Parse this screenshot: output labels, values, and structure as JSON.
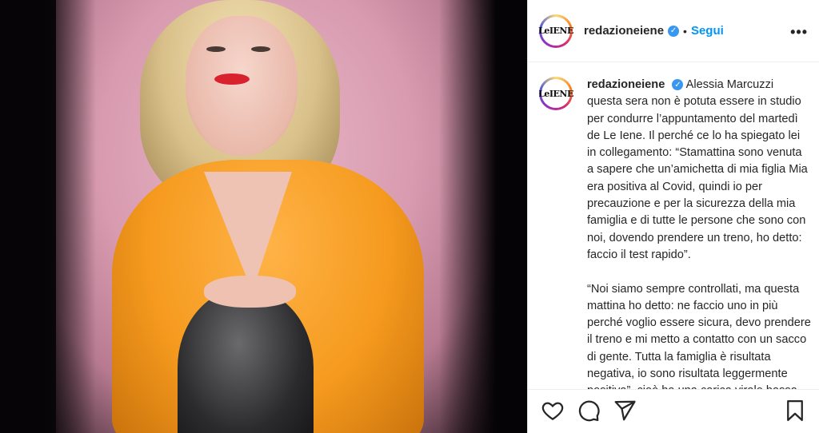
{
  "post": {
    "username": "redazioneiene",
    "follow_label": "Segui",
    "separator": "•",
    "more_label": "•••",
    "avatar_logo": "LeIENE"
  },
  "caption": {
    "username": "redazioneiene",
    "text": "Alessia Marcuzzi questa sera non è potuta essere in studio per condurre l’appuntamento del martedì de Le Iene. Il perché ce lo ha spiegato lei in collegamento: “Stamattina sono venuta a sapere che un’amichetta di mia figlia Mia era positiva al Covid, quindi io per precauzione e per la sicurezza della mia famiglia e di tutte le persone che sono con noi, dovendo prendere un treno, ho detto: faccio il test rapido”.\n\n“Noi siamo sempre controllati, ma questa mattina ho detto: ne faccio uno in più perché voglio essere sicura, devo prendere il treno e mi metto a contatto con un sacco di gente. Tutta la famiglia è risultata negativa, io sono risultata leggermente positiva”, cioè ha una carica virale bassa. Adesso Alessia è in"
  },
  "icons": {
    "like": "heart-icon",
    "comment": "comment-icon",
    "share": "share-icon",
    "save": "bookmark-icon",
    "verified": "verified-badge-icon"
  },
  "colors": {
    "follow": "#0095f6",
    "verified": "#3897f0",
    "text": "#262626"
  }
}
